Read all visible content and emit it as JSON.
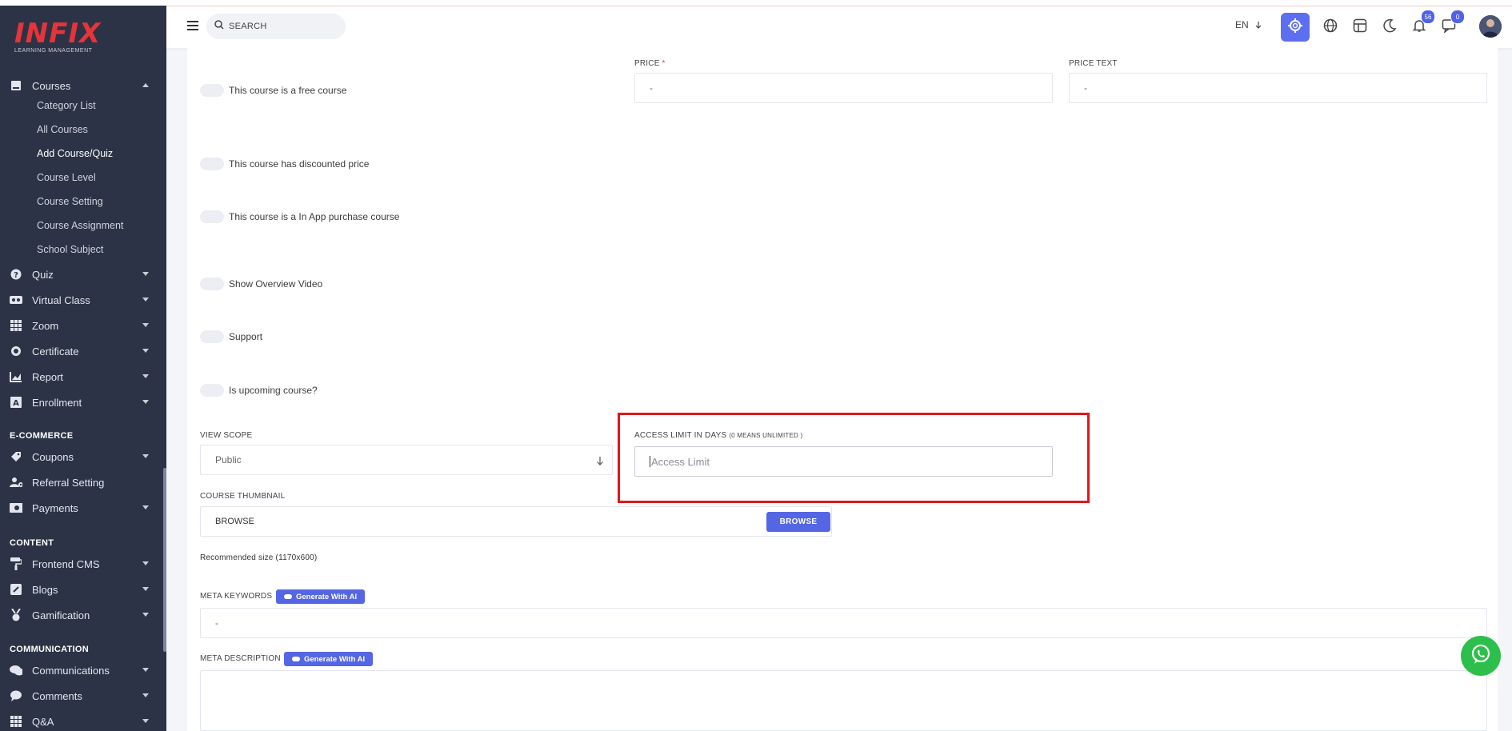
{
  "brand": {
    "logo": "INFIX",
    "tagline": "LEARNING MANAGEMENT"
  },
  "sidebar": {
    "courses_label": "Courses",
    "course_sub": [
      "Category List",
      "All Courses",
      "Add Course/Quiz",
      "Course Level",
      "Course Setting",
      "Course Assignment",
      "School Subject"
    ],
    "main_items": [
      "Quiz",
      "Virtual Class",
      "Zoom",
      "Certificate",
      "Report",
      "Enrollment"
    ],
    "sections": {
      "ecommerce": "E-COMMERCE",
      "content": "CONTENT",
      "communication": "COMMUNICATION"
    },
    "ecommerce_items": [
      "Coupons",
      "Referral Setting",
      "Payments"
    ],
    "content_items": [
      "Frontend CMS",
      "Blogs",
      "Gamification"
    ],
    "communication_items": [
      "Communications",
      "Comments",
      "Q&A"
    ]
  },
  "header": {
    "search_placeholder": "SEARCH",
    "language": "EN",
    "notifications_count": "56",
    "messages_count": "0"
  },
  "form": {
    "price_label": "PRICE",
    "price_required": "*",
    "price_value": "-",
    "price_text_label": "PRICE TEXT",
    "price_text_value": "-",
    "toggles": [
      "This course is a free course",
      "This course has discounted price",
      "This course is a In App purchase course",
      "Show Overview Video",
      "Support",
      "Is upcoming course?"
    ],
    "view_scope_label": "VIEW SCOPE",
    "view_scope_value": "Public",
    "access_limit_label": "ACCESS LIMIT IN DAYS",
    "access_limit_hint": "(0 MEANS UNLIMITED )",
    "access_limit_placeholder": "Access Limit",
    "thumbnail_label": "COURSE THUMBNAIL",
    "thumbnail_value": "BROWSE",
    "browse_button": "BROWSE",
    "recommended_size": "Recommended size (1170x600)",
    "meta_keywords_label": "META KEYWORDS",
    "meta_keywords_value": "-",
    "meta_description_label": "META DESCRIPTION",
    "generate_ai": "Generate With AI"
  },
  "colors": {
    "sidebar_bg": "#2c3346",
    "accent": "#5566e4",
    "highlight_border": "#e0161c",
    "whatsapp": "#2dbf4b"
  }
}
